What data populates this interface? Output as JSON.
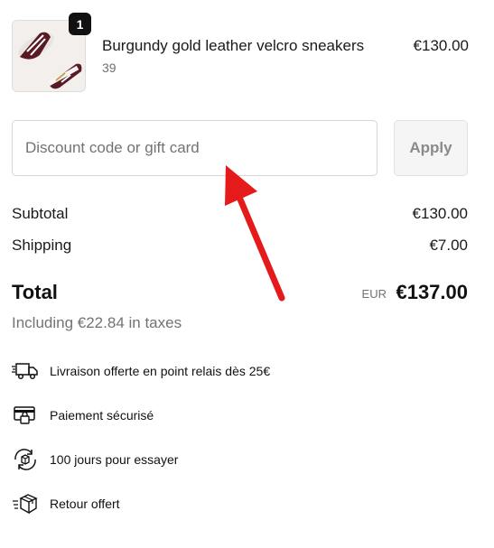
{
  "product": {
    "quantity": "1",
    "name": "Burgundy gold leather velcro sneakers",
    "variant": "39",
    "price": "€130.00"
  },
  "discount": {
    "placeholder": "Discount code or gift card",
    "value": "",
    "apply_label": "Apply"
  },
  "summary": {
    "subtotal_label": "Subtotal",
    "subtotal_value": "€130.00",
    "shipping_label": "Shipping",
    "shipping_value": "€7.00",
    "total_label": "Total",
    "currency": "EUR",
    "total_value": "€137.00",
    "taxes_note": "Including €22.84 in taxes"
  },
  "perks": [
    {
      "icon": "delivery-truck-icon",
      "label": "Livraison offerte en point relais dès 25€"
    },
    {
      "icon": "secure-payment-card-icon",
      "label": "Paiement sécurisé"
    },
    {
      "icon": "returns-cycle-icon",
      "label": "100 jours pour essayer"
    },
    {
      "icon": "return-box-icon",
      "label": "Retour offert"
    }
  ],
  "colors": {
    "arrow": "#e51b1b",
    "sneaker": "#5a1a24",
    "gold": "#c9a35a"
  }
}
